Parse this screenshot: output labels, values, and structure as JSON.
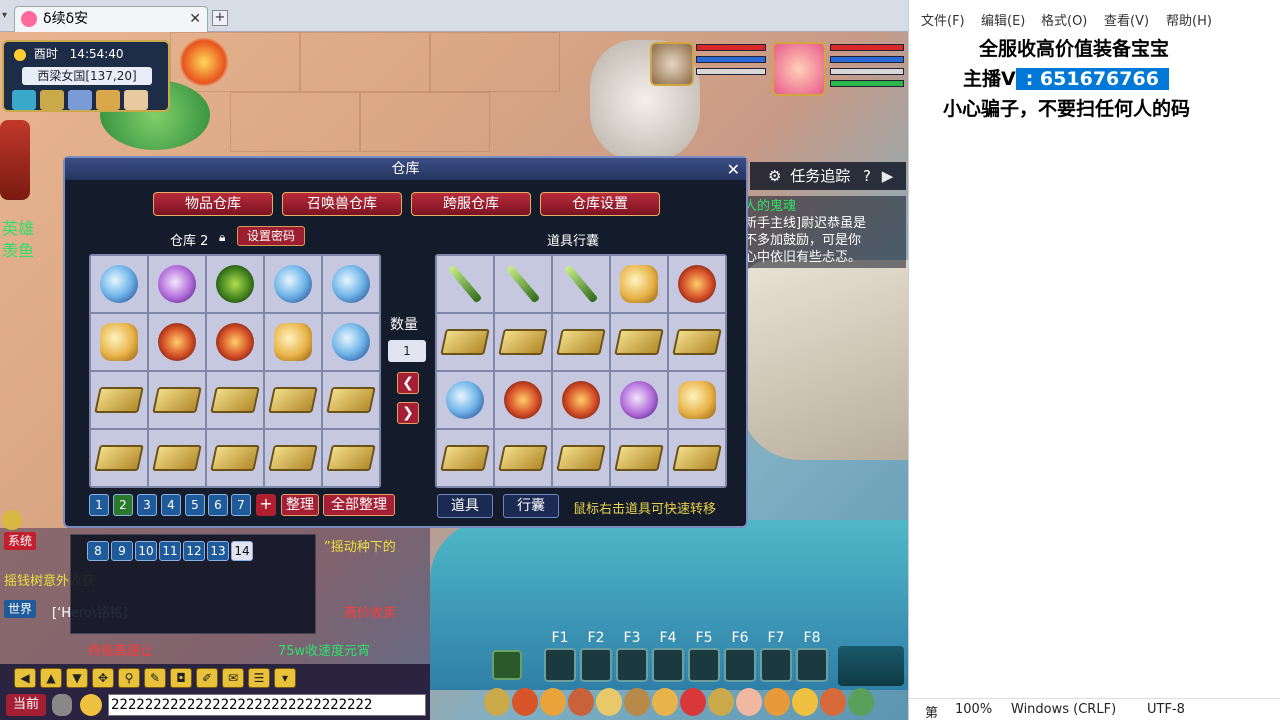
{
  "browser": {
    "tab_title": "δ续δ安",
    "close": "✕",
    "new_tab": "+"
  },
  "hud": {
    "time_label": "酉时",
    "clock": "14:54:40",
    "location": "西梁女国[137,20]"
  },
  "warehouse": {
    "title": "仓库",
    "close": "✕",
    "tabs": [
      "物品仓库",
      "召唤兽仓库",
      "跨服仓库",
      "仓库设置"
    ],
    "left_section": "仓库 2",
    "set_password": "设置密码",
    "right_section": "道具行囊",
    "qty_label": "数量",
    "qty_value": "1",
    "prev": "❮",
    "next": "❯",
    "pages": [
      "1",
      "2",
      "3",
      "4",
      "5",
      "6",
      "7"
    ],
    "add_page": "+",
    "sort": "整理",
    "sort_all": "全部整理",
    "bag_tab_items": "道具",
    "bag_tab_pack": "行囊",
    "tip": "鼠标右击道具可快速转移",
    "left_items": [
      "orb",
      "purple",
      "green",
      "orb",
      "orb",
      "gold",
      "fire",
      "fire",
      "gold",
      "orb",
      "book",
      "book",
      "book",
      "book",
      "book",
      "book",
      "book",
      "book",
      "book",
      "book"
    ],
    "right_items": [
      "sword",
      "sword",
      "sword",
      "gold",
      "fire",
      "book",
      "book",
      "book",
      "book",
      "book",
      "orb",
      "fire",
      "fire",
      "purple",
      "gold",
      "book",
      "book",
      "book",
      "book",
      "book"
    ]
  },
  "task": {
    "title": "任务追踪",
    "help": "?",
    "collapse": "▶",
    "lines": [
      "人的鬼魂",
      "新手主线]尉迟恭虽是",
      "不多加鼓励，可是你",
      "心中依旧有些忐忑。"
    ]
  },
  "left_labels": {
    "hero": "英雄",
    "fish": "羡鱼"
  },
  "chat": {
    "page_numbers": [
      "8",
      "9",
      "10",
      "11",
      "12",
      "13",
      "14"
    ],
    "tag_system": "系统",
    "tag_world": "世界",
    "line1": "”摇动种下的",
    "line2": "摇钱树意外收获",
    "line3": "[‘Hero\\铭铭]",
    "line3b": "高价收卖",
    "line4": "终极高速让",
    "line5": "75w收速度元宵",
    "current": "当前",
    "input_value": "2222222222222222222222222222222"
  },
  "fkeys": [
    "F1",
    "F2",
    "F3",
    "F4",
    "F5",
    "F6",
    "F7",
    "F8"
  ],
  "notepad": {
    "menu": [
      "文件(F)",
      "编辑(E)",
      "格式(O)",
      "查看(V)",
      "帮助(H)"
    ],
    "line1": "全服收高价值装备宝宝",
    "line2_prefix": "主播V",
    "line2_selected": ": 651676766",
    "line3": "小心骗子，不要扫任何人的码",
    "status": {
      "position": "第",
      "zoom": "100%",
      "eol": "Windows (CRLF)",
      "encoding": "UTF-8"
    }
  }
}
